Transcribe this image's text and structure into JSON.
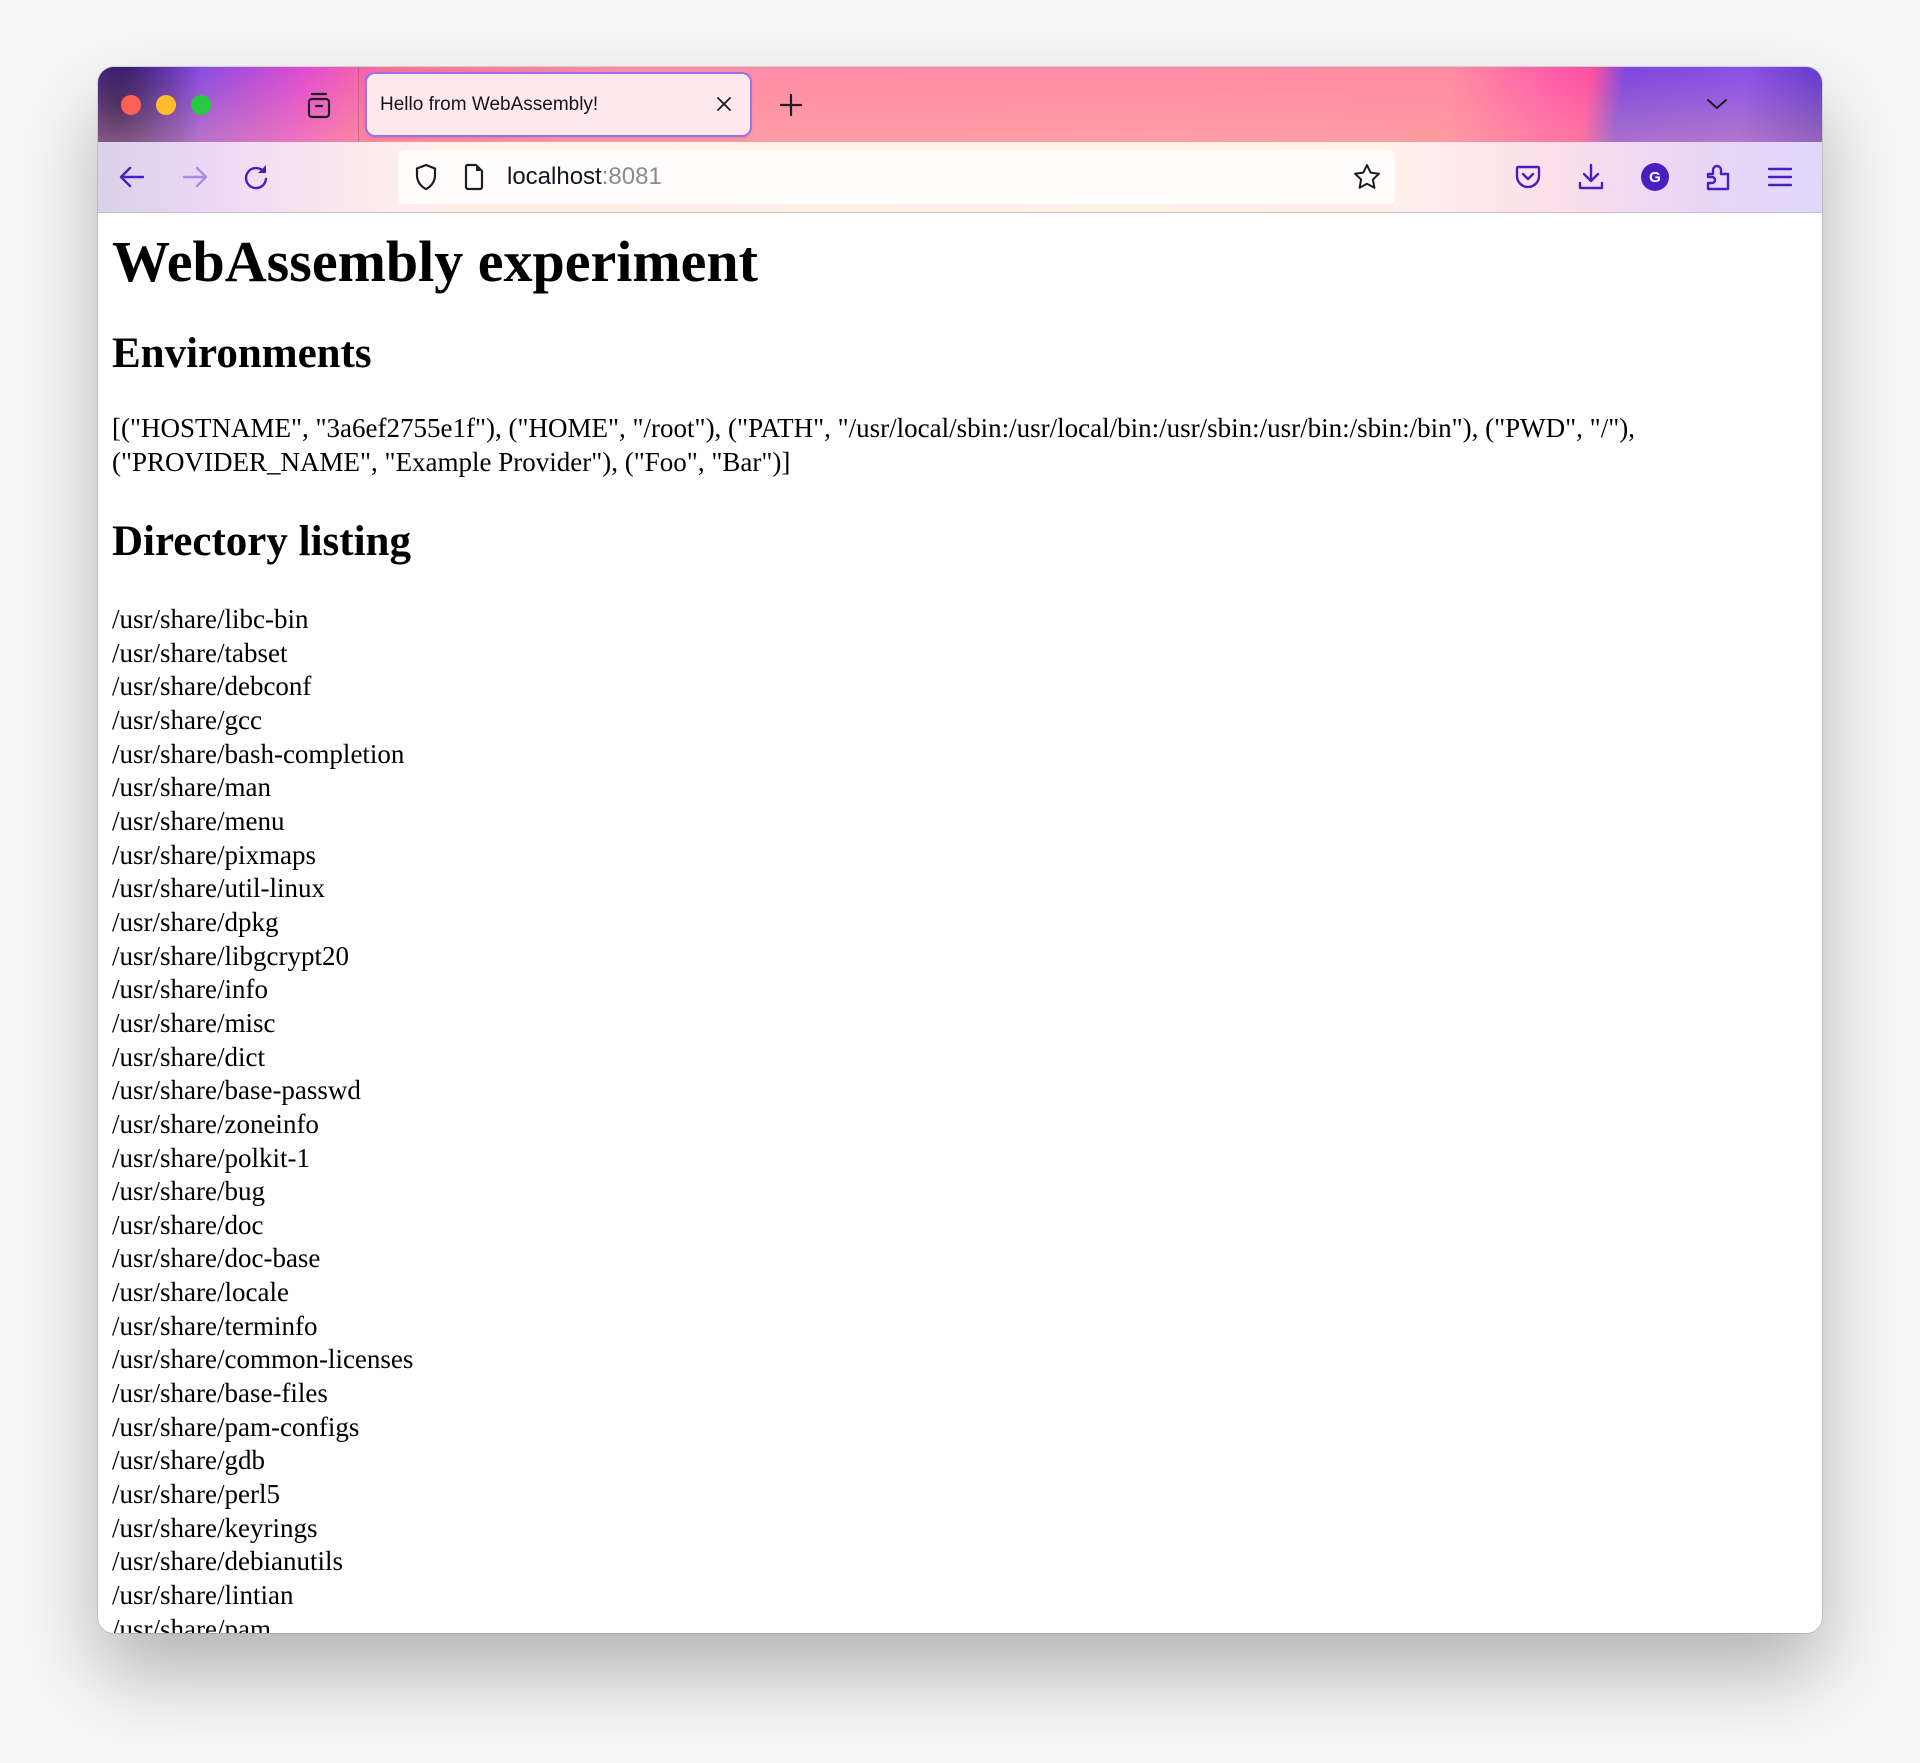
{
  "browser": {
    "tab": {
      "title": "Hello from WebAssembly!"
    },
    "url": {
      "host": "localhost",
      "port": ":8081"
    },
    "colors": {
      "icon": "#4a1fc2",
      "tab_bg": "#fde8ee",
      "avatar": "#4a1fc2"
    },
    "avatar_letter": "G"
  },
  "page": {
    "title": "WebAssembly experiment",
    "environments": {
      "heading": "Environments",
      "text": "[(\"HOSTNAME\", \"3a6ef2755e1f\"), (\"HOME\", \"/root\"), (\"PATH\", \"/usr/local/sbin:/usr/local/bin:/usr/sbin:/usr/bin:/sbin:/bin\"), (\"PWD\", \"/\"), (\"PROVIDER_NAME\", \"Example Provider\"), (\"Foo\", \"Bar\")]"
    },
    "directory": {
      "heading": "Directory listing",
      "items": [
        "/usr/share/libc-bin",
        "/usr/share/tabset",
        "/usr/share/debconf",
        "/usr/share/gcc",
        "/usr/share/bash-completion",
        "/usr/share/man",
        "/usr/share/menu",
        "/usr/share/pixmaps",
        "/usr/share/util-linux",
        "/usr/share/dpkg",
        "/usr/share/libgcrypt20",
        "/usr/share/info",
        "/usr/share/misc",
        "/usr/share/dict",
        "/usr/share/base-passwd",
        "/usr/share/zoneinfo",
        "/usr/share/polkit-1",
        "/usr/share/bug",
        "/usr/share/doc",
        "/usr/share/doc-base",
        "/usr/share/locale",
        "/usr/share/terminfo",
        "/usr/share/common-licenses",
        "/usr/share/base-files",
        "/usr/share/pam-configs",
        "/usr/share/gdb",
        "/usr/share/perl5",
        "/usr/share/keyrings",
        "/usr/share/debianutils",
        "/usr/share/lintian",
        "/usr/share/pam"
      ]
    }
  }
}
